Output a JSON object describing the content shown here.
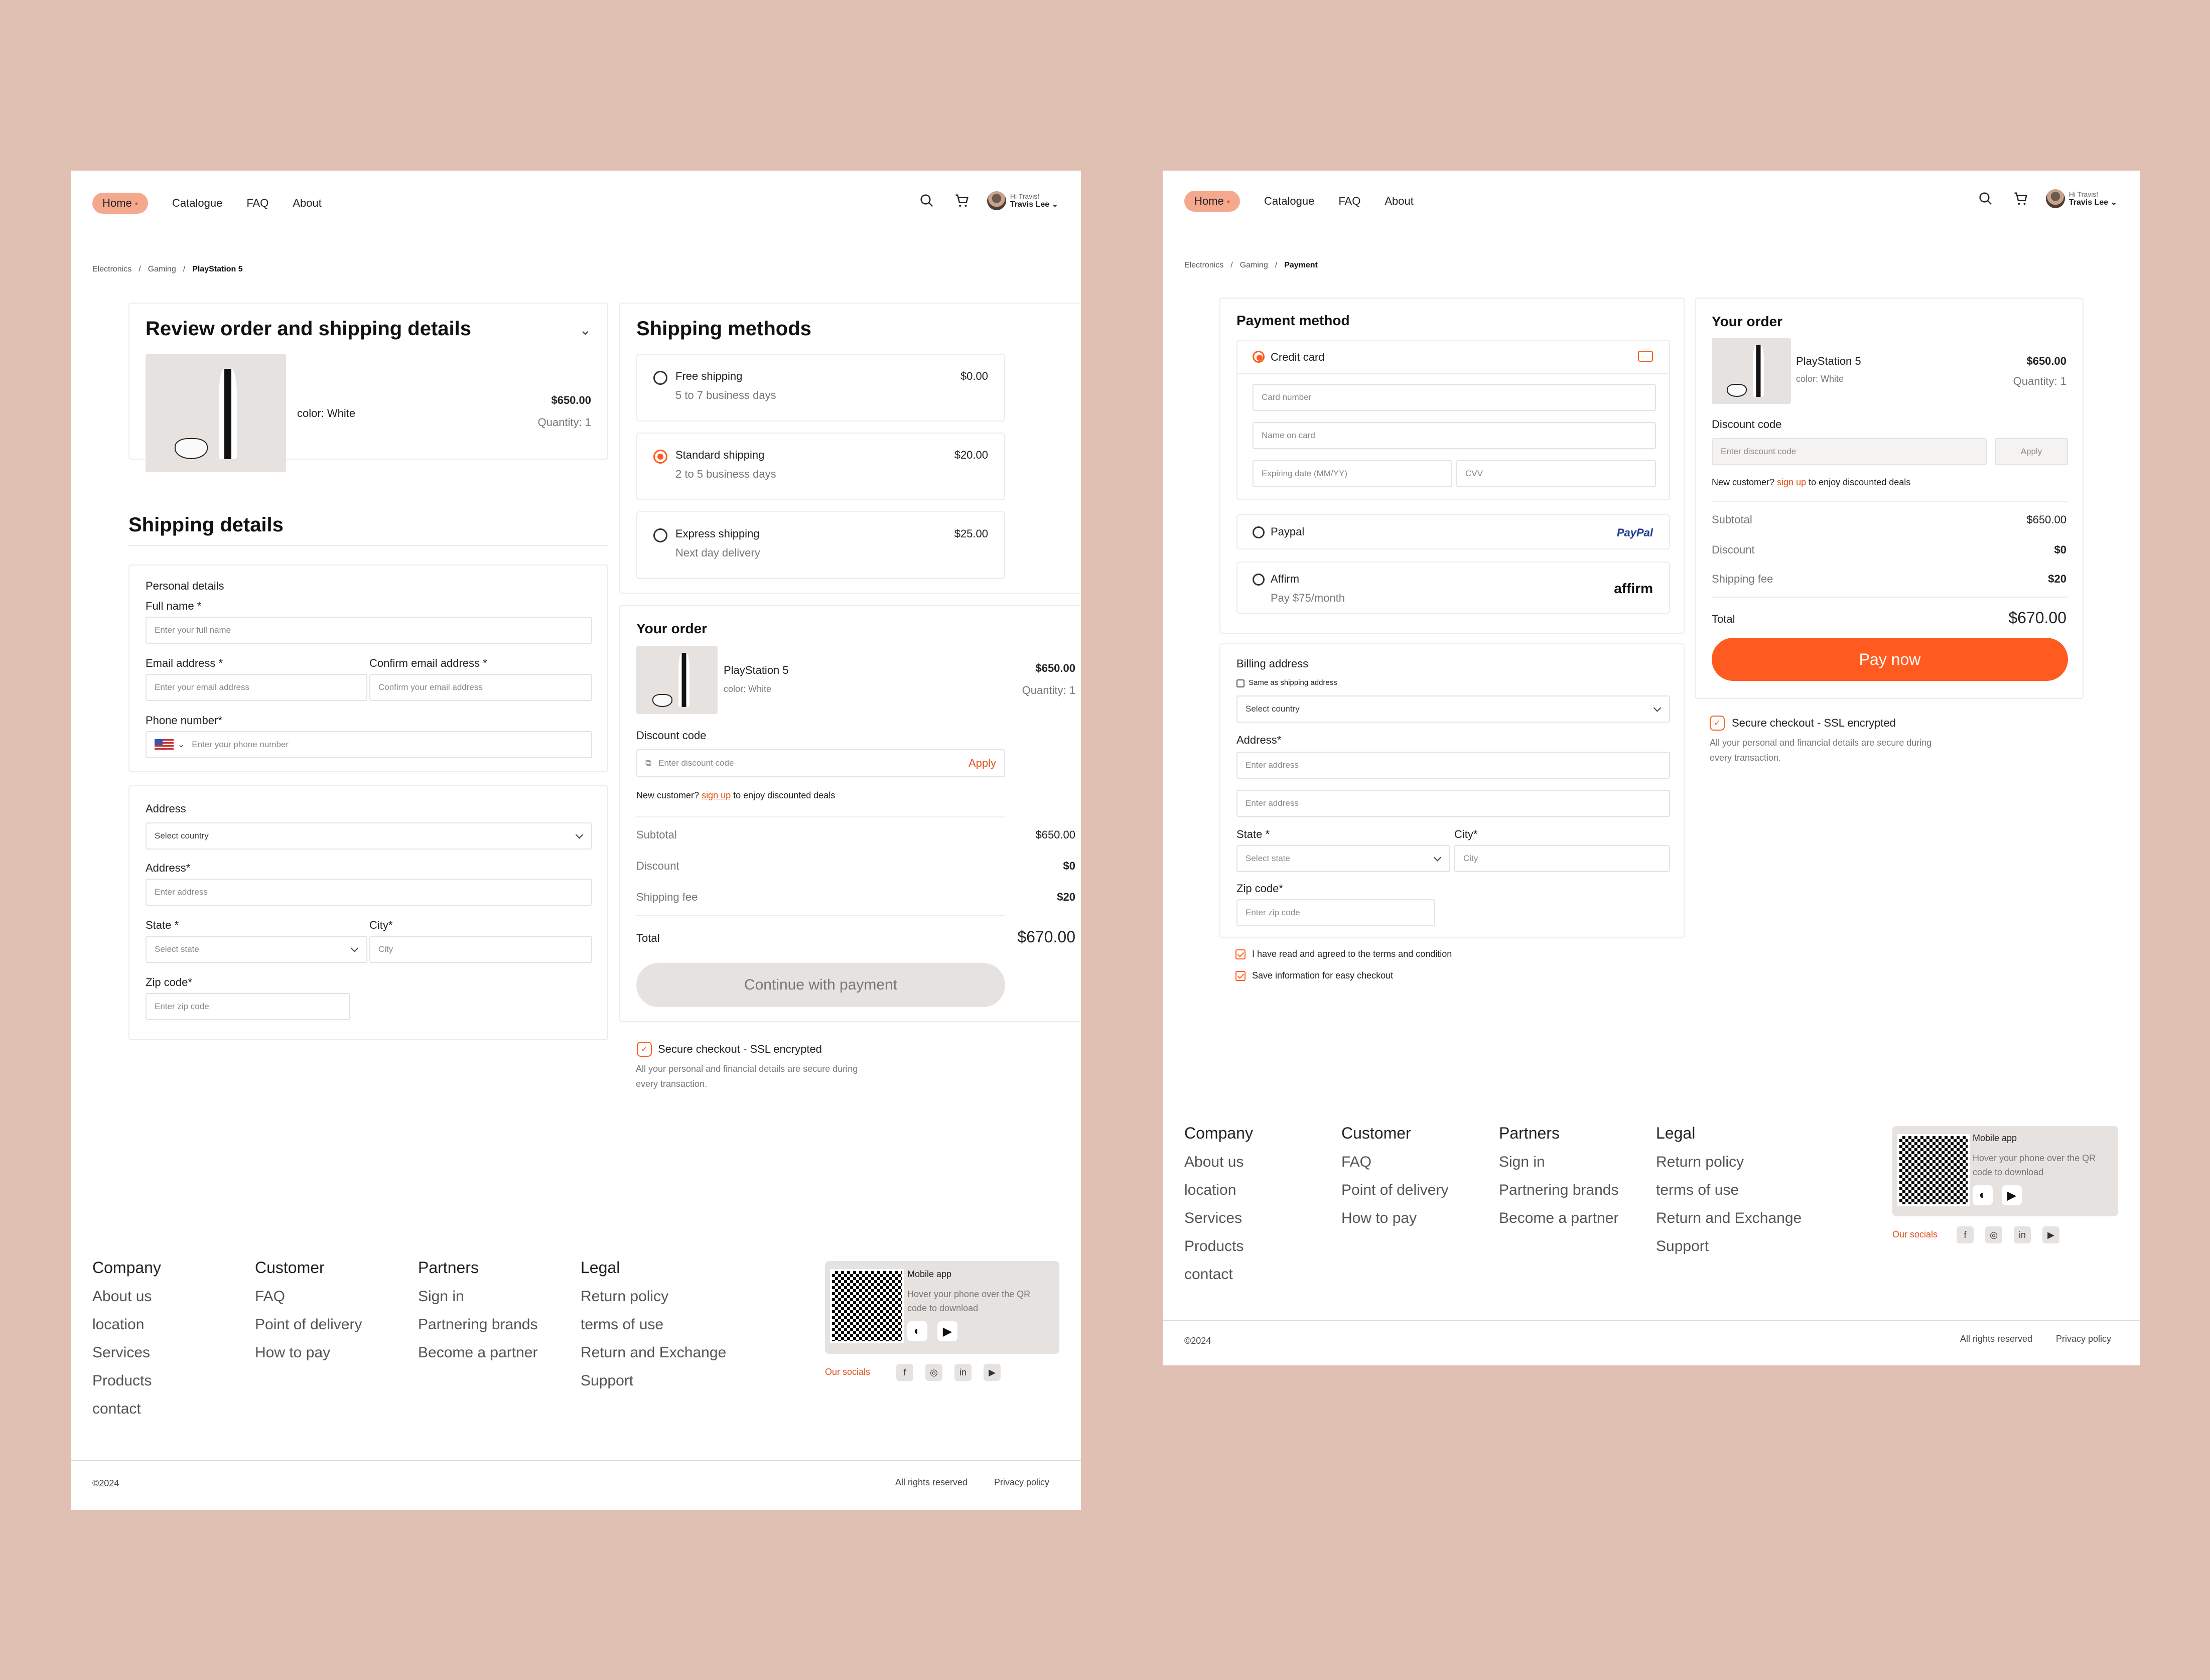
{
  "header": {
    "nav": [
      "Home",
      "Catalogue",
      "FAQ",
      "About"
    ],
    "greeting": "Hi Travis!",
    "user_name": "Travis Lee"
  },
  "left": {
    "breadcrumb": [
      "Electronics",
      "Gaming",
      "PlayStation 5"
    ],
    "review_title": "Review order and shipping details",
    "product_color": "color: White",
    "product_price": "$650.00",
    "product_qty": "Quantity: 1",
    "shipping_details_title": "Shipping details",
    "personal_details": "Personal details",
    "full_name_label": "Full name *",
    "full_name_placeholder": "Enter your full name",
    "email_label": "Email address *",
    "email_placeholder": "Enter your email address",
    "confirm_email_label": "Confirm email address *",
    "confirm_email_placeholder": "Confirm your email address",
    "phone_label": "Phone number*",
    "phone_placeholder": "Enter your phone number",
    "address_section": "Address",
    "country_placeholder": "Select country",
    "address_label": "Address*",
    "address_placeholder": "Enter address",
    "state_label": "State *",
    "state_placeholder": "Select state",
    "city_label": "City*",
    "city_placeholder": "City",
    "zip_label": "Zip code*",
    "zip_placeholder": "Enter zip code",
    "shipping_methods_title": "Shipping methods",
    "methods": [
      {
        "name": "Free shipping",
        "desc": "5 to 7 business days",
        "price": "$0.00",
        "selected": false
      },
      {
        "name": "Standard shipping",
        "desc": "2 to 5 business days",
        "price": "$20.00",
        "selected": true
      },
      {
        "name": "Express shipping",
        "desc": "Next day delivery",
        "price": "$25.00",
        "selected": false
      }
    ],
    "order": {
      "title": "Your order",
      "product": "PlayStation 5",
      "color": "color: White",
      "price": "$650.00",
      "qty": "Quantity: 1",
      "discount_label": "Discount code",
      "discount_placeholder": "Enter discount code",
      "apply": "Apply",
      "new_customer": "New customer?",
      "sign_up": "sign up",
      "deals": "to enjoy discounted deals",
      "subtotal_label": "Subtotal",
      "subtotal": "$650.00",
      "discount_row_label": "Discount",
      "discount": "$0",
      "shipping_label": "Shipping fee",
      "shipping": "$20",
      "total_label": "Total",
      "total": "$670.00",
      "button": "Continue with payment"
    },
    "secure_title": "Secure checkout - SSL encrypted",
    "secure_text_1": "All your personal and financial details are secure during",
    "secure_text_2": "every transaction."
  },
  "right": {
    "breadcrumb": [
      "Electronics",
      "Gaming",
      "Payment"
    ],
    "payment_title": "Payment method",
    "credit_card": "Credit card",
    "card_number": "Card number",
    "name_on_card": "Name on card",
    "expiry": "Expiring date (MM/YY)",
    "cvv": "CVV",
    "paypal": "Paypal",
    "paypal_logo": "PayPal",
    "affirm": "Affirm",
    "affirm_desc": "Pay $75/month",
    "affirm_logo": "affirm",
    "billing_title": "Billing address",
    "same_as_shipping": "Same as shipping address",
    "country_placeholder": "Select country",
    "address_label": "Address*",
    "address_placeholder": "Enter address",
    "state_label": "State *",
    "state_placeholder": "Select state",
    "city_label": "City*",
    "city_placeholder": "City",
    "zip_label": "Zip code*",
    "zip_placeholder": "Enter zip code",
    "terms": "I have read and agreed to the terms and condition",
    "save_info": "Save information for easy checkout",
    "order": {
      "title": "Your order",
      "product": "PlayStation 5",
      "color": "color: White",
      "price": "$650.00",
      "qty": "Quantity: 1",
      "discount_label": "Discount code",
      "discount_placeholder": "Enter discount code",
      "apply": "Apply",
      "new_customer": "New customer?",
      "sign_up": "sign up",
      "deals": "to enjoy discounted deals",
      "subtotal_label": "Subtotal",
      "subtotal": "$650.00",
      "discount_row_label": "Discount",
      "discount": "$0",
      "shipping_label": "Shipping fee",
      "shipping": "$20",
      "total_label": "Total",
      "total": "$670.00",
      "button": "Pay now"
    },
    "secure_title": "Secure checkout - SSL encrypted",
    "secure_text_1": "All your personal and financial details are secure during",
    "secure_text_2": "every transaction."
  },
  "footer": {
    "company": {
      "title": "Company",
      "items": [
        "About us",
        "location",
        "Services",
        "Products",
        "contact"
      ]
    },
    "customer": {
      "title": "Customer",
      "items": [
        "FAQ",
        "Point of delivery",
        "How to pay"
      ]
    },
    "partners": {
      "title": "Partners",
      "items": [
        "Sign in",
        "Partnering brands",
        "Become a partner"
      ]
    },
    "legal": {
      "title": "Legal",
      "items": [
        "Return policy",
        "terms of use",
        "Return and Exchange",
        "Support"
      ]
    },
    "app_title": "Mobile app",
    "app_text_1": "Hover your phone over the QR",
    "app_text_2": "code to download",
    "socials": "Our socials",
    "copyright": "©2024",
    "rights": "All rights reserved",
    "privacy": "Privacy policy"
  },
  "colors": {
    "accent": "#ff5a1f",
    "background": "#e0c0b3",
    "pill": "#f4a98f"
  }
}
